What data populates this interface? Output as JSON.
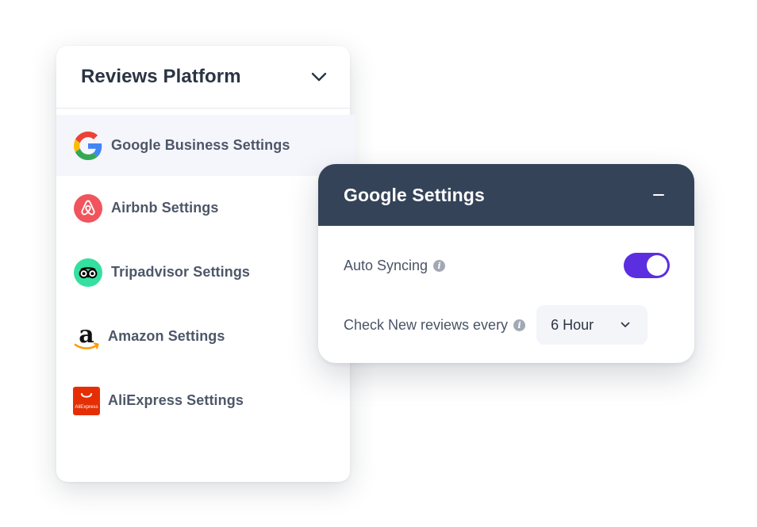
{
  "platform_panel": {
    "title": "Reviews Platform",
    "items": [
      {
        "label": "Google Business Settings",
        "icon": "google-icon",
        "active": true
      },
      {
        "label": "Airbnb Settings",
        "icon": "airbnb-icon",
        "active": false
      },
      {
        "label": "Tripadvisor Settings",
        "icon": "tripadvisor-icon",
        "active": false
      },
      {
        "label": "Amazon Settings",
        "icon": "amazon-icon",
        "active": false
      },
      {
        "label": "AliExpress Settings",
        "icon": "aliexpress-icon",
        "active": false
      }
    ]
  },
  "settings_card": {
    "title": "Google Settings",
    "auto_sync": {
      "label": "Auto Syncing",
      "enabled": true
    },
    "check_interval": {
      "label": "Check New reviews every",
      "selected": "6 Hour"
    }
  },
  "colors": {
    "card_header_bg": "#344358",
    "toggle_on": "#5b2ee0",
    "active_item_bg": "#f5f5fc",
    "airbnb": "#f0545c",
    "tripadvisor": "#34e0a1",
    "amazon_smile": "#ff9900",
    "aliexpress": "#e62e04"
  }
}
